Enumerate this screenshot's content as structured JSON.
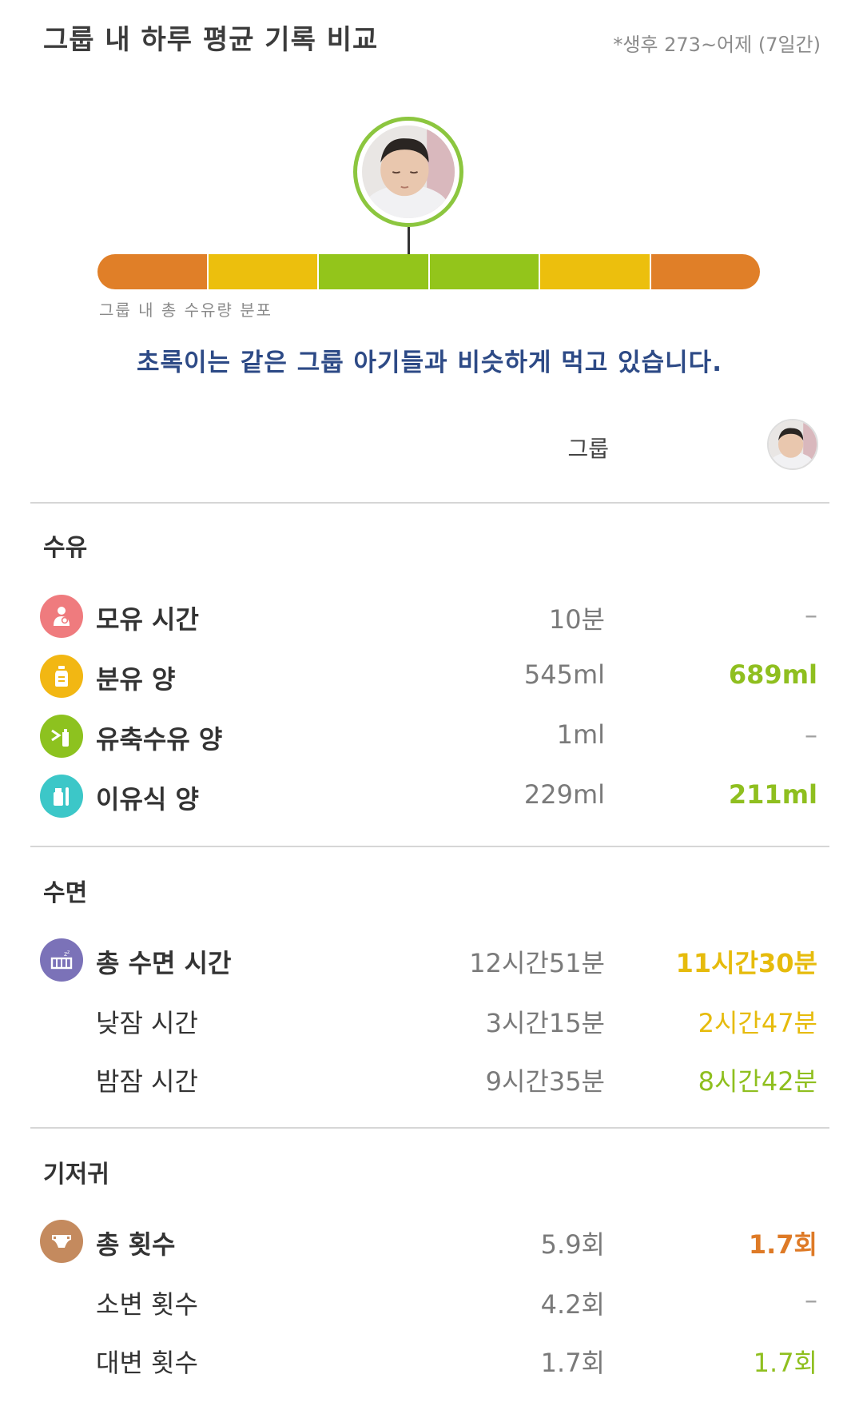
{
  "header": {
    "title": "그룹 내 하루 평균 기록 비교",
    "period": "*생후 273~어제 (7일간)"
  },
  "distribution": {
    "label": "그룹 내 총 수유량 분포",
    "segment_colors": [
      "#e07f28",
      "#ecbf0d",
      "#93c51b",
      "#93c51b",
      "#ecbf0d",
      "#e07f28"
    ]
  },
  "message": "초록이는 같은 그룹 아기들과 비슷하게 먹고 있습니다.",
  "columns": {
    "group": "그룹"
  },
  "colors": {
    "orange": "#de7a26",
    "yellow": "#e6bb0c",
    "green": "#8fbf1f",
    "gray": "#a0a0a0",
    "navy": "#2d4a86"
  },
  "sections": {
    "feeding": {
      "title": "수유",
      "rows": [
        {
          "icon": "breastfeeding-icon",
          "icon_color": "#ef7b7e",
          "label": "모유 시간",
          "group": "10분",
          "baby": "–",
          "baby_color": "#a0a0a0"
        },
        {
          "icon": "formula-bottle-icon",
          "icon_color": "#f2b713",
          "label": "분유 양",
          "group": "545ml",
          "baby": "689ml",
          "baby_color": "#8fbf1f"
        },
        {
          "icon": "pumped-milk-icon",
          "icon_color": "#8dc21f",
          "label": "유축수유 양",
          "group": "1ml",
          "baby": "–",
          "baby_color": "#a0a0a0"
        },
        {
          "icon": "baby-food-icon",
          "icon_color": "#3cc7c8",
          "label": "이유식 양",
          "group": "229ml",
          "baby": "211ml",
          "baby_color": "#8fbf1f"
        }
      ]
    },
    "sleep": {
      "title": "수면",
      "rows": [
        {
          "icon": "crib-icon",
          "icon_color": "#7b72b8",
          "label": "총 수면 시간",
          "group": "12시간51분",
          "baby": "11시간30분",
          "baby_color": "#e6bb0c"
        },
        {
          "label": "낮잠 시간",
          "group": "3시간15분",
          "baby": "2시간47분",
          "baby_color": "#e6bb0c"
        },
        {
          "label": "밤잠 시간",
          "group": "9시간35분",
          "baby": "8시간42분",
          "baby_color": "#8fbf1f"
        }
      ]
    },
    "diaper": {
      "title": "기저귀",
      "rows": [
        {
          "icon": "diaper-icon",
          "icon_color": "#c48a5e",
          "label": "총 횟수",
          "group": "5.9회",
          "baby": "1.7회",
          "baby_color": "#de7a26"
        },
        {
          "label": "소변 횟수",
          "group": "4.2회",
          "baby": "–",
          "baby_color": "#a0a0a0"
        },
        {
          "label": "대변 횟수",
          "group": "1.7회",
          "baby": "1.7회",
          "baby_color": "#8fbf1f"
        }
      ]
    }
  }
}
